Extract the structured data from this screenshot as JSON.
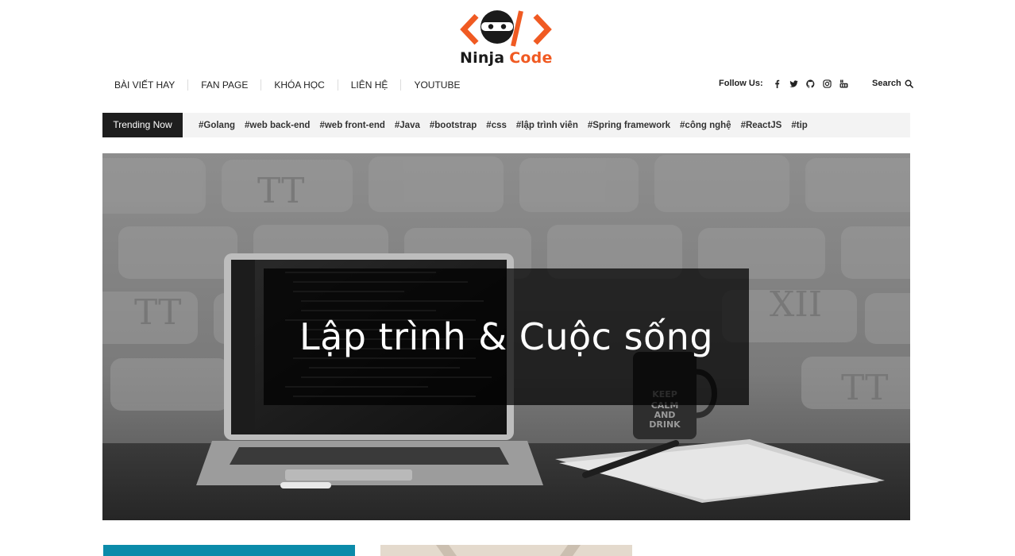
{
  "brand": {
    "name_part1": "Ninja",
    "name_part2": "Code",
    "accent": "#f05a22",
    "icon": "ninja-code-logo"
  },
  "nav": {
    "items": [
      {
        "label": "BÀI VIẾT HAY"
      },
      {
        "label": "FAN PAGE"
      },
      {
        "label": "KHÓA HỌC"
      },
      {
        "label": "LIÊN HỆ"
      },
      {
        "label": "YOUTUBE"
      }
    ]
  },
  "follow": {
    "label": "Follow Us:",
    "icons": [
      "facebook-icon",
      "twitter-icon",
      "github-icon",
      "instagram-icon",
      "youtube-icon"
    ]
  },
  "search": {
    "label": "Search",
    "icon": "search-icon"
  },
  "trending": {
    "label": "Trending Now",
    "tags": [
      "#Golang",
      "#web back-end",
      "#web front-end",
      "#Java",
      "#bootstrap",
      "#css",
      "#lập trình viên",
      "#Spring framework",
      "#công nghệ",
      "#ReactJS",
      "#tip"
    ]
  },
  "hero": {
    "title": "Lập trình & Cuộc sống"
  },
  "colors": {
    "trending_label_bg": "#1e1e1e",
    "trending_bar_bg": "#f3f3f3",
    "card1": "#0b8baa",
    "card2": "#e4dacd"
  }
}
